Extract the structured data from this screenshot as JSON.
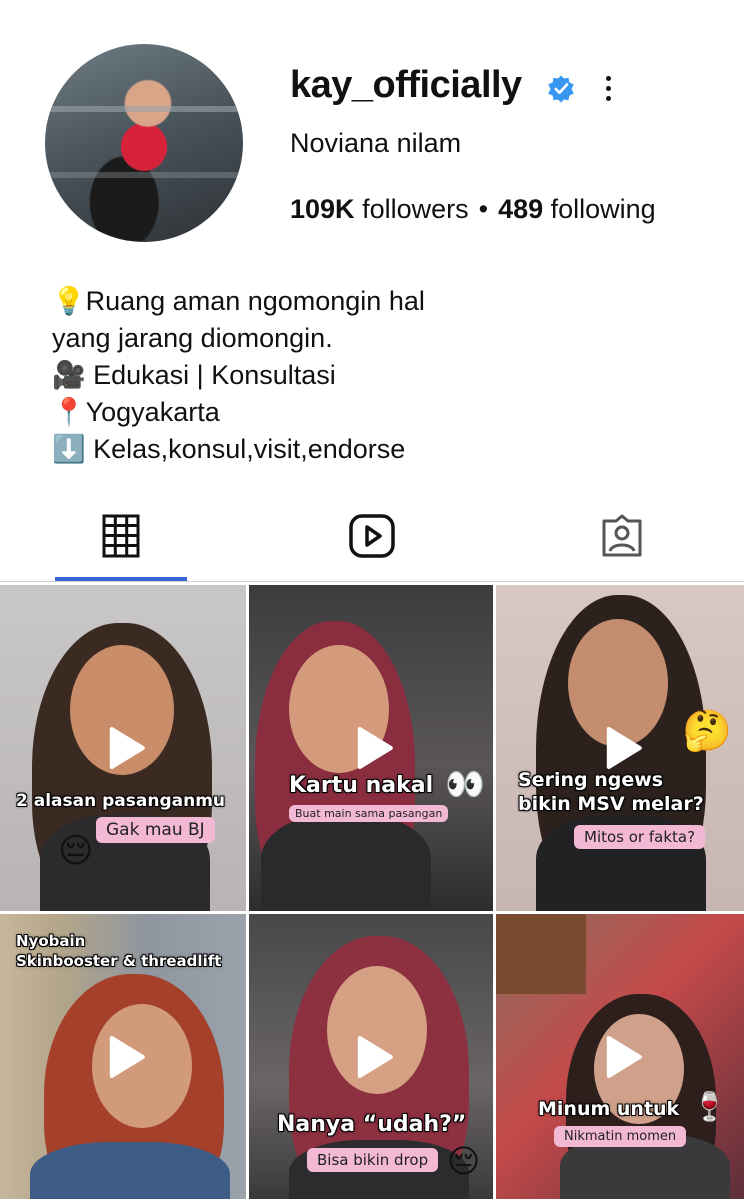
{
  "profile": {
    "username": "kay_officially",
    "full_name": "Noviana nilam",
    "followers_count": "109K",
    "followers_label": "followers",
    "separator": "•",
    "following_count": "489",
    "following_label": "following",
    "verified": true,
    "accent_color": "#3897f0"
  },
  "bio": {
    "lines": [
      "💡Ruang aman ngomongin hal",
      "yang jarang diomongin.",
      "🎥 Edukasi | Konsultasi",
      "📍Yogyakarta",
      "⬇️ Kelas,konsul,visit,endorse"
    ]
  },
  "tabs": [
    {
      "name": "grid",
      "icon": "grid-icon",
      "active": true
    },
    {
      "name": "reels",
      "icon": "reels-icon",
      "active": false
    },
    {
      "name": "tagged",
      "icon": "tagged-icon",
      "active": false
    }
  ],
  "posts": [
    {
      "caption": "2 alasan pasanganmu",
      "sub": "Gak mau BJ",
      "emoji": "😔"
    },
    {
      "caption": "Kartu nakal",
      "sub": "Buat main sama pasangan",
      "emoji": "👀"
    },
    {
      "caption_line1": "Sering ngews",
      "caption_line2": "bikin MSV melar?",
      "sub": "Mitos or fakta?",
      "emoji": "🤔"
    },
    {
      "caption_line1": "Nyobain",
      "caption_line2": "Skinbooster & threadlift"
    },
    {
      "caption": "Nanya “udah?”",
      "sub": "Bisa bikin drop",
      "emoji": "😔"
    },
    {
      "caption": "Minum untuk",
      "sub": "Nikmatin momen",
      "emoji": "🍷"
    }
  ]
}
